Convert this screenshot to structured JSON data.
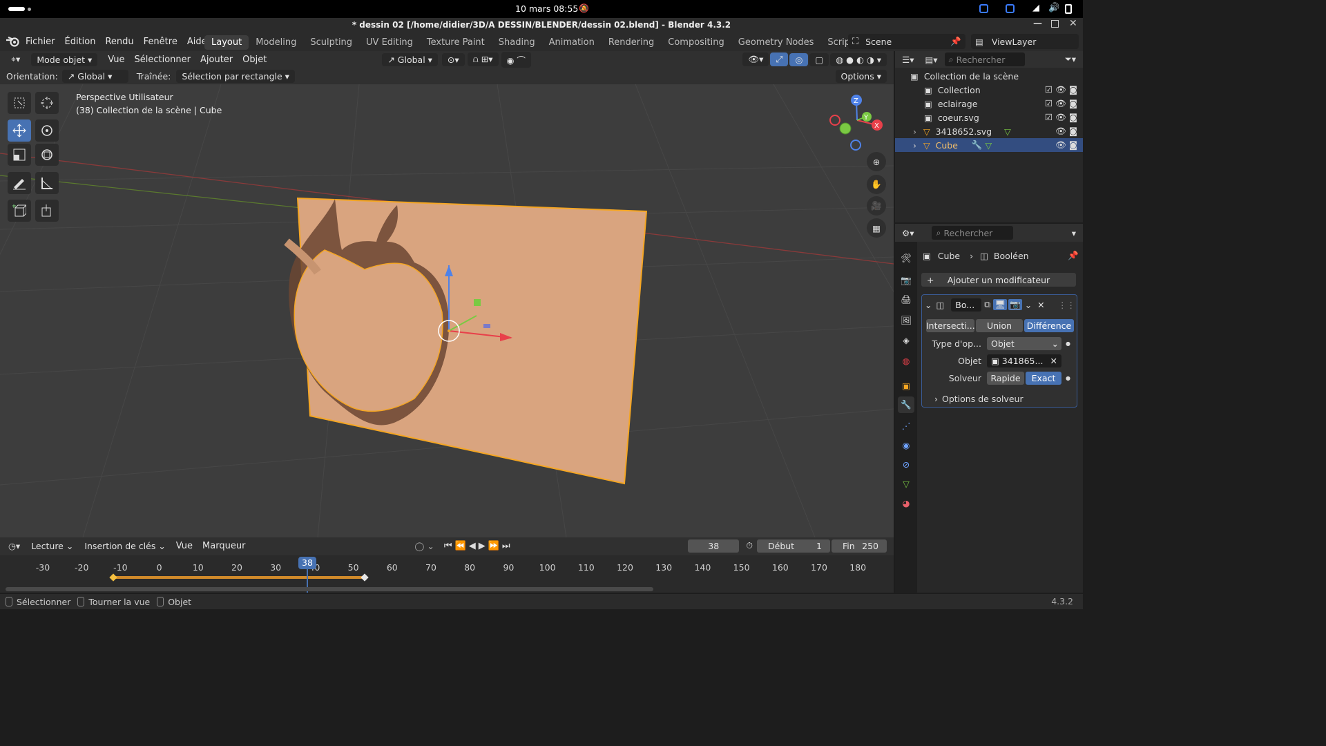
{
  "system": {
    "datetime": "10 mars  08:55"
  },
  "window": {
    "title": "* dessin 02 [/home/didier/3D/A DESSIN/BLENDER/dessin 02.blend] - Blender 4.3.2"
  },
  "menu": [
    "Fichier",
    "Édition",
    "Rendu",
    "Fenêtre",
    "Aide"
  ],
  "workspaces": [
    "Layout",
    "Modeling",
    "Sculpting",
    "UV Editing",
    "Texture Paint",
    "Shading",
    "Animation",
    "Rendering",
    "Compositing",
    "Geometry Nodes",
    "Scripting"
  ],
  "scene": {
    "name": "Scene",
    "view_layer": "ViewLayer"
  },
  "viewport": {
    "mode": "Mode objet",
    "menus": [
      "Vue",
      "Sélectionner",
      "Ajouter",
      "Objet"
    ],
    "transform": "Global",
    "options": "Options",
    "orientation_label": "Orientation:",
    "orientation_value": "Global",
    "drag_label": "Traînée:",
    "drag_value": "Sélection par rectangle",
    "info_line1": "Perspective Utilisateur",
    "info_line2": "(38) Collection de la scène | Cube",
    "gizmo_axes": {
      "z": "Z",
      "y": "Y",
      "x": "X"
    }
  },
  "outliner": {
    "search_placeholder": "Rechercher",
    "root": "Collection de la scène",
    "items": [
      {
        "label": "Collection"
      },
      {
        "label": "eclairage"
      },
      {
        "label": "coeur.svg"
      },
      {
        "label": "3418652.svg"
      },
      {
        "label": "Cube"
      }
    ]
  },
  "properties": {
    "search_placeholder": "Rechercher",
    "breadcrumb_object": "Cube",
    "breadcrumb_modifier": "Booléen",
    "add_modifier": "Ajouter un modificateur",
    "modifier_name": "Bo...",
    "ops": [
      "Intersecti...",
      "Union",
      "Différence"
    ],
    "operand_label": "Type d'op...",
    "operand_value": "Objet",
    "object_label": "Objet",
    "object_value": "341865...",
    "solver_label": "Solveur",
    "solver_fast": "Rapide",
    "solver_exact": "Exact",
    "solver_options": "Options de solveur"
  },
  "timeline": {
    "playback": "Lecture",
    "keying": "Insertion de clés",
    "view": "Vue",
    "marker": "Marqueur",
    "current_frame": "38",
    "start_label": "Début",
    "start_value": "1",
    "end_label": "Fin",
    "end_value": "250",
    "ticks": [
      "-30",
      "-20",
      "-10",
      "0",
      "10",
      "20",
      "30",
      "40",
      "50",
      "60",
      "70",
      "80",
      "90",
      "100",
      "110",
      "120",
      "130",
      "140",
      "150",
      "160",
      "170",
      "180"
    ],
    "playhead": "38"
  },
  "status": {
    "select": "Sélectionner",
    "rotate": "Tourner la vue",
    "object": "Objet",
    "version": "4.3.2"
  },
  "colors": {
    "accent": "#4772b3",
    "selection_orange": "#f5a623",
    "object_fill": "#d9a47f"
  }
}
